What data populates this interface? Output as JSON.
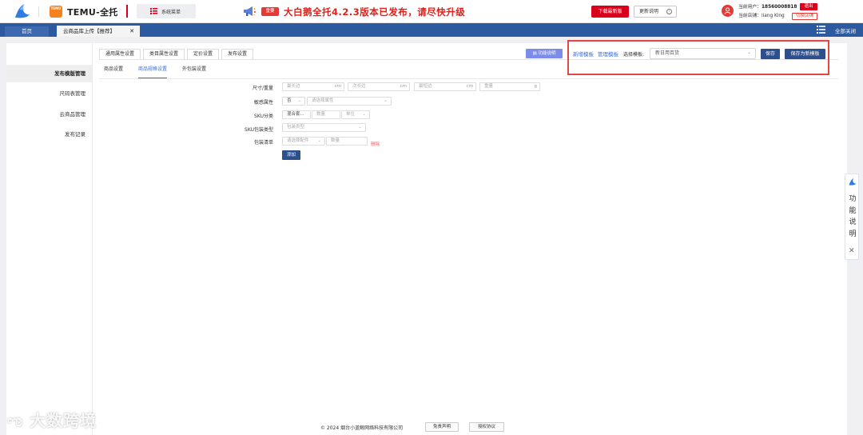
{
  "header": {
    "brand": "TEMU-全托",
    "logo_text": "TEMU",
    "system_menu": "系统菜单",
    "notice_badge": "重要",
    "notice": "大白鹅全托4.2.3版本已发布，请尽快升级",
    "download_btn": "下载最新版",
    "update_btn": "更新说明",
    "user_label": "当前用户：",
    "user_phone": "18560008818",
    "logout": "退出",
    "shop_label": "当前店铺：",
    "shop_name": "liang King",
    "switch_shop": "切换店铺"
  },
  "nav": {
    "home": "首页",
    "active_tab": "云商品库上传【推荐】",
    "close_all": "全部关闭"
  },
  "sidebar": {
    "items": [
      {
        "label": "发布模版管理"
      },
      {
        "label": "尺码表管理"
      },
      {
        "label": "云商品管理"
      },
      {
        "label": "发布记录"
      }
    ]
  },
  "main": {
    "tabs": [
      {
        "label": "通用属性设置"
      },
      {
        "label": "类目属性设置"
      },
      {
        "label": "定价设置"
      },
      {
        "label": "发布设置"
      }
    ],
    "func_btn": "功能说明",
    "new_template": "新增模板",
    "manage_template": "管理模板",
    "choose_label": "选择模板:",
    "template_value": "新日用百货",
    "save_btn": "保存",
    "save_as_btn": "保存为新模板",
    "subtabs": [
      {
        "label": "商品设置"
      },
      {
        "label": "商品规格设置"
      },
      {
        "label": "外包装设置"
      }
    ]
  },
  "form": {
    "size_label": "尺寸/重量",
    "longest_ph": "最长边",
    "second_ph": "次长边",
    "shortest_ph": "最短边",
    "weight_ph": "重量",
    "unit_cm": "cm",
    "unit_g": "g",
    "sensitive_label": "敏感属性",
    "sensitive_value": "否",
    "sensitive_attr_ph": "请选择属性",
    "sku_cat_label": "SKU分类",
    "sku_cat_value": "混合套...",
    "qty_ph": "数量",
    "unit_ph": "单位",
    "sku_pack_label": "SKU包装类型",
    "pack_type_ph": "包装类型",
    "pack_list_label": "包装清单",
    "accessory_ph": "请选择配件",
    "delete": "删除",
    "add_btn": "添加"
  },
  "float_help": {
    "chars": [
      "功",
      "能",
      "说",
      "明"
    ]
  },
  "footer": {
    "copyright": "© 2024 烟台小蓝鲸网络科技有限公司",
    "disclaimer": "免责声明",
    "license": "授权协议"
  },
  "watermark": "大数跨境",
  "colors": {
    "primary": "#2c4f8e",
    "nav": "#2c5aa0",
    "danger": "#d9001b",
    "link": "#3a6edb",
    "temu": "#f5821f"
  },
  "icons": {
    "logo": "bird-logo-icon",
    "menu": "list-menu-icon",
    "speaker": "megaphone-icon",
    "info": "info-icon",
    "user": "user-avatar-icon",
    "hamburger": "hamburger-icon",
    "close": "close-icon"
  }
}
